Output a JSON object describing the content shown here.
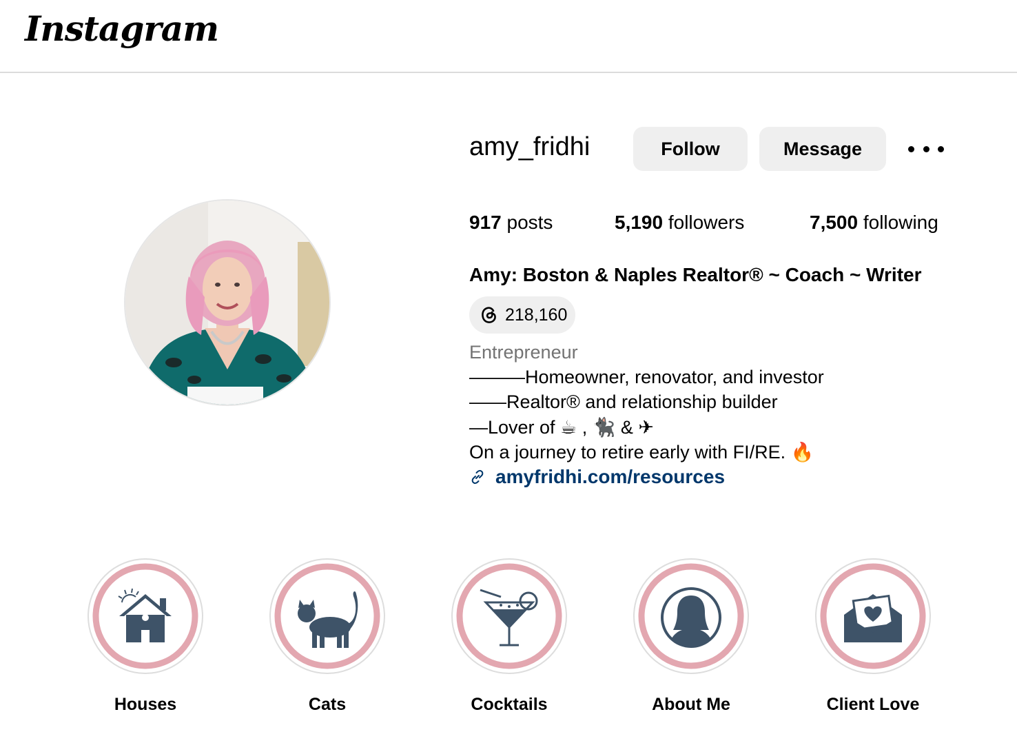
{
  "header": {
    "logo_text": "Instagram"
  },
  "profile": {
    "username": "amy_fridhi",
    "follow_label": "Follow",
    "message_label": "Message",
    "more_icon": "more-horizontal-icon",
    "stats": {
      "posts_count": "917",
      "posts_label": "posts",
      "followers_count": "5,190",
      "followers_label": "followers",
      "following_count": "7,500",
      "following_label": "following"
    },
    "full_name": "Amy: Boston & Naples Realtor® ~ Coach ~ Writer",
    "threads": {
      "icon": "threads-icon",
      "count": "218,160"
    },
    "category": "Entrepreneur",
    "bio_lines": [
      "———Homeowner, renovator, and investor",
      "——Realtor® and relationship builder",
      "—Lover of ☕ , 🐈‍⬛ & ✈",
      "On a journey to retire early with FI/RE. 🔥"
    ],
    "link": {
      "icon": "link-icon",
      "text": "amyfridhi.com/resources",
      "color": "#00376b"
    }
  },
  "highlights": [
    {
      "label": "Houses",
      "icon": "house-icon"
    },
    {
      "label": "Cats",
      "icon": "cat-icon"
    },
    {
      "label": "Cocktails",
      "icon": "cocktail-icon"
    },
    {
      "label": "About Me",
      "icon": "person-icon"
    },
    {
      "label": "Client Love",
      "icon": "envelope-heart-icon"
    }
  ],
  "colors": {
    "highlight_ring": "#e3a7b0",
    "highlight_icon": "#3e5368",
    "button_bg": "#efefef"
  }
}
